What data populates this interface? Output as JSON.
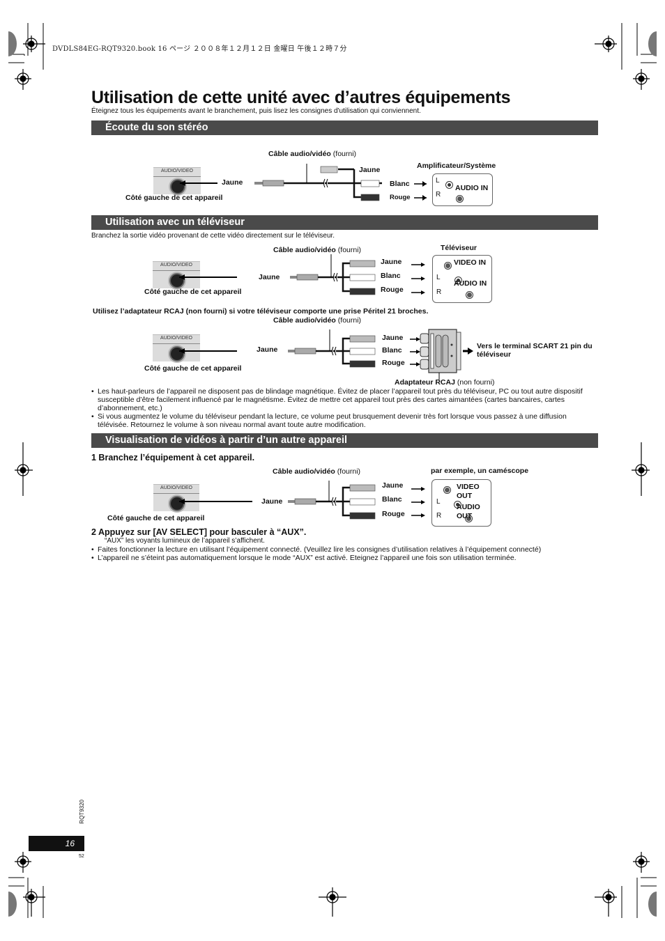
{
  "print_header": "DVDLS84EG-RQT9320.book  16 ページ  ２００８年１２月１２日  金曜日  午後１２時７分",
  "title": "Utilisation de cette unité avec d’autres équipements",
  "intro": "Éteignez tous les équipements avant le branchement, puis lisez les consignes d'utilisation qui conviennent.",
  "sections": {
    "stereo": {
      "heading": "Écoute du son stéréo",
      "cable_label": "Câble audio/vidéo",
      "cable_note": "(fourni)",
      "jack_label": "AUDIO/VIDEO",
      "plug_color": "Jaune",
      "unit_side": "Côté gauche de cet appareil",
      "branch_jaune": "Jaune",
      "branch_blanc": "Blanc",
      "branch_rouge": "Rouge",
      "device_title": "Amplificateur/Système",
      "port_l": "L",
      "port_r": "R",
      "port_label": "AUDIO IN"
    },
    "tv": {
      "heading": "Utilisation avec un téléviseur",
      "intro": "Branchez la sortie vidéo provenant de cette vidéo directement sur le téléviseur.",
      "cable_label": "Câble audio/vidéo",
      "cable_note": "(fourni)",
      "jack_label": "AUDIO/VIDEO",
      "plug_color": "Jaune",
      "unit_side": "Côté gauche de cet appareil",
      "branches": [
        "Jaune",
        "Blanc",
        "Rouge"
      ],
      "device_title": "Téléviseur",
      "video_in": "VIDEO IN",
      "port_l": "L",
      "port_r": "R",
      "audio_in": "AUDIO IN",
      "scart_note": "Utilisez l’adaptateur RCAJ (non fourni) si votre téléviseur comporte une prise Péritel 21 broches.",
      "scart_cable_label": "Câble audio/vidéo",
      "scart_cable_note": "(fourni)",
      "scart_jack_label": "AUDIO/VIDEO",
      "scart_plug_color": "Jaune",
      "scart_unit_side": "Côté gauche de cet appareil",
      "scart_branches": [
        "Jaune",
        "Blanc",
        "Rouge"
      ],
      "scart_target": "Vers le terminal SCART 21 pin du téléviseur",
      "adapter_label": "Adaptateur RCAJ",
      "adapter_note": "(non fourni)",
      "bullets": [
        "Les haut-parleurs de l’appareil ne disposent pas de blindage magnétique. Évitez de placer l’appareil tout près du téléviseur, PC ou tout autre dispositif susceptible d’être facilement influencé par le magnétisme. Évitez de mettre cet appareil tout près des cartes aimantées (cartes bancaires, cartes d’abonnement, etc.)",
        "Si vous augmentez le volume du téléviseur pendant la lecture, ce volume peut brusquement devenir très fort lorsque vous passez à une diffusion télévisée. Retournez le volume à son niveau normal avant toute autre modification."
      ]
    },
    "video": {
      "heading": "Visualisation de vidéos à partir d’un autre appareil",
      "step1": "1  Branchez l’équipement à cet appareil.",
      "cable_label": "Câble audio/vidéo",
      "cable_note": "(fourni)",
      "jack_label": "AUDIO/VIDEO",
      "plug_color": "Jaune",
      "unit_side": "Côté gauche de cet appareil",
      "branches": [
        "Jaune",
        "Blanc",
        "Rouge"
      ],
      "device_title": "par exemple, un caméscope",
      "video_out_1": "VIDEO",
      "video_out_2": "OUT",
      "audio_out_1": "AUDIO",
      "audio_out_2": "OUT",
      "port_l": "L",
      "port_r": "R",
      "step2": "2  Appuyez sur [AV SELECT] pour basculer à “AUX”.",
      "step2_sub": "“AUX” les voyants lumineux de l’appareil s’affichent.",
      "bullets": [
        "Faites fonctionner la lecture en utilisant l’équipement connecté. (Veuillez lire les consignes d’utilisation relatives à l’équipement connecté)",
        "L’appareil ne s’éteint pas automatiquement lorsque le mode “AUX” est activé. Eteignez l’appareil une fois son utilisation terminée."
      ]
    }
  },
  "footer": {
    "doc_code": "RQT9320",
    "page_number": "16",
    "sub_number": "52"
  },
  "colors": {
    "section_bar": "#4a4a4a",
    "page_badge": "#111111"
  }
}
